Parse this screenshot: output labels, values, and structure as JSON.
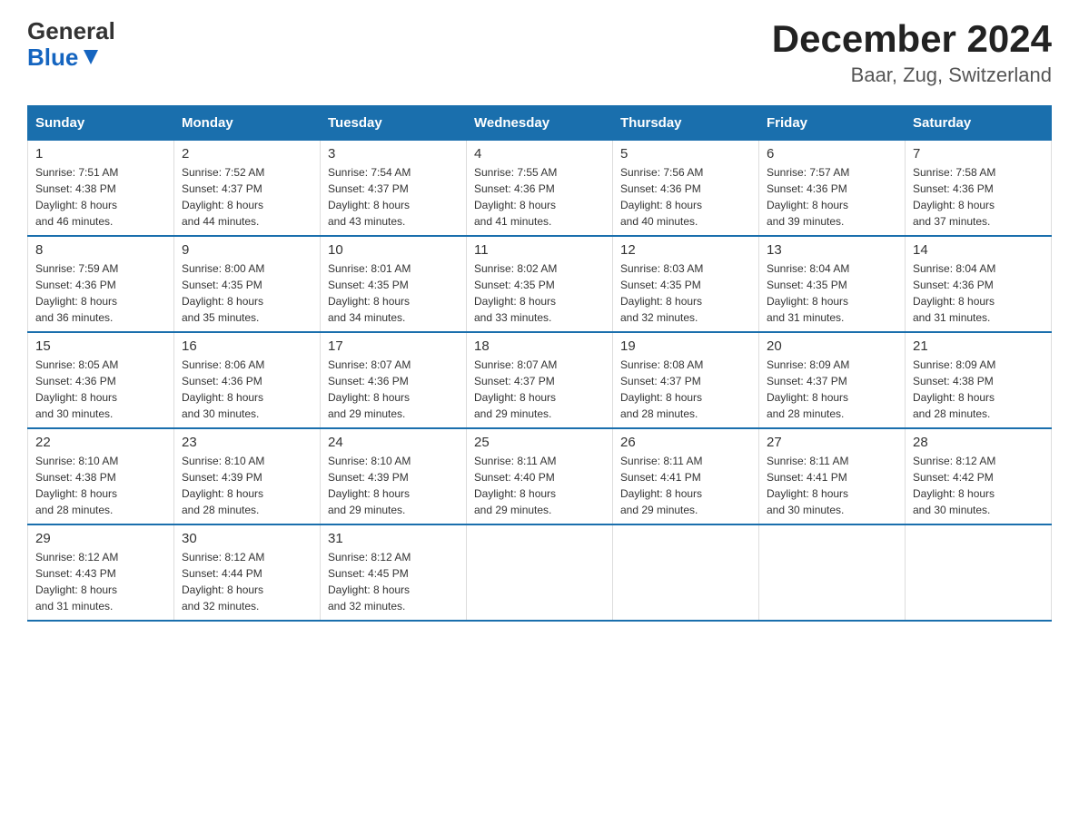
{
  "brand": {
    "line1": "General",
    "line2": "Blue"
  },
  "title": "December 2024",
  "subtitle": "Baar, Zug, Switzerland",
  "days_header": [
    "Sunday",
    "Monday",
    "Tuesday",
    "Wednesday",
    "Thursday",
    "Friday",
    "Saturday"
  ],
  "weeks": [
    [
      {
        "num": "1",
        "sunrise": "7:51 AM",
        "sunset": "4:38 PM",
        "daylight": "8 hours and 46 minutes."
      },
      {
        "num": "2",
        "sunrise": "7:52 AM",
        "sunset": "4:37 PM",
        "daylight": "8 hours and 44 minutes."
      },
      {
        "num": "3",
        "sunrise": "7:54 AM",
        "sunset": "4:37 PM",
        "daylight": "8 hours and 43 minutes."
      },
      {
        "num": "4",
        "sunrise": "7:55 AM",
        "sunset": "4:36 PM",
        "daylight": "8 hours and 41 minutes."
      },
      {
        "num": "5",
        "sunrise": "7:56 AM",
        "sunset": "4:36 PM",
        "daylight": "8 hours and 40 minutes."
      },
      {
        "num": "6",
        "sunrise": "7:57 AM",
        "sunset": "4:36 PM",
        "daylight": "8 hours and 39 minutes."
      },
      {
        "num": "7",
        "sunrise": "7:58 AM",
        "sunset": "4:36 PM",
        "daylight": "8 hours and 37 minutes."
      }
    ],
    [
      {
        "num": "8",
        "sunrise": "7:59 AM",
        "sunset": "4:36 PM",
        "daylight": "8 hours and 36 minutes."
      },
      {
        "num": "9",
        "sunrise": "8:00 AM",
        "sunset": "4:35 PM",
        "daylight": "8 hours and 35 minutes."
      },
      {
        "num": "10",
        "sunrise": "8:01 AM",
        "sunset": "4:35 PM",
        "daylight": "8 hours and 34 minutes."
      },
      {
        "num": "11",
        "sunrise": "8:02 AM",
        "sunset": "4:35 PM",
        "daylight": "8 hours and 33 minutes."
      },
      {
        "num": "12",
        "sunrise": "8:03 AM",
        "sunset": "4:35 PM",
        "daylight": "8 hours and 32 minutes."
      },
      {
        "num": "13",
        "sunrise": "8:04 AM",
        "sunset": "4:35 PM",
        "daylight": "8 hours and 31 minutes."
      },
      {
        "num": "14",
        "sunrise": "8:04 AM",
        "sunset": "4:36 PM",
        "daylight": "8 hours and 31 minutes."
      }
    ],
    [
      {
        "num": "15",
        "sunrise": "8:05 AM",
        "sunset": "4:36 PM",
        "daylight": "8 hours and 30 minutes."
      },
      {
        "num": "16",
        "sunrise": "8:06 AM",
        "sunset": "4:36 PM",
        "daylight": "8 hours and 30 minutes."
      },
      {
        "num": "17",
        "sunrise": "8:07 AM",
        "sunset": "4:36 PM",
        "daylight": "8 hours and 29 minutes."
      },
      {
        "num": "18",
        "sunrise": "8:07 AM",
        "sunset": "4:37 PM",
        "daylight": "8 hours and 29 minutes."
      },
      {
        "num": "19",
        "sunrise": "8:08 AM",
        "sunset": "4:37 PM",
        "daylight": "8 hours and 28 minutes."
      },
      {
        "num": "20",
        "sunrise": "8:09 AM",
        "sunset": "4:37 PM",
        "daylight": "8 hours and 28 minutes."
      },
      {
        "num": "21",
        "sunrise": "8:09 AM",
        "sunset": "4:38 PM",
        "daylight": "8 hours and 28 minutes."
      }
    ],
    [
      {
        "num": "22",
        "sunrise": "8:10 AM",
        "sunset": "4:38 PM",
        "daylight": "8 hours and 28 minutes."
      },
      {
        "num": "23",
        "sunrise": "8:10 AM",
        "sunset": "4:39 PM",
        "daylight": "8 hours and 28 minutes."
      },
      {
        "num": "24",
        "sunrise": "8:10 AM",
        "sunset": "4:39 PM",
        "daylight": "8 hours and 29 minutes."
      },
      {
        "num": "25",
        "sunrise": "8:11 AM",
        "sunset": "4:40 PM",
        "daylight": "8 hours and 29 minutes."
      },
      {
        "num": "26",
        "sunrise": "8:11 AM",
        "sunset": "4:41 PM",
        "daylight": "8 hours and 29 minutes."
      },
      {
        "num": "27",
        "sunrise": "8:11 AM",
        "sunset": "4:41 PM",
        "daylight": "8 hours and 30 minutes."
      },
      {
        "num": "28",
        "sunrise": "8:12 AM",
        "sunset": "4:42 PM",
        "daylight": "8 hours and 30 minutes."
      }
    ],
    [
      {
        "num": "29",
        "sunrise": "8:12 AM",
        "sunset": "4:43 PM",
        "daylight": "8 hours and 31 minutes."
      },
      {
        "num": "30",
        "sunrise": "8:12 AM",
        "sunset": "4:44 PM",
        "daylight": "8 hours and 32 minutes."
      },
      {
        "num": "31",
        "sunrise": "8:12 AM",
        "sunset": "4:45 PM",
        "daylight": "8 hours and 32 minutes."
      },
      null,
      null,
      null,
      null
    ]
  ],
  "labels": {
    "sunrise": "Sunrise:",
    "sunset": "Sunset:",
    "daylight": "Daylight:"
  }
}
